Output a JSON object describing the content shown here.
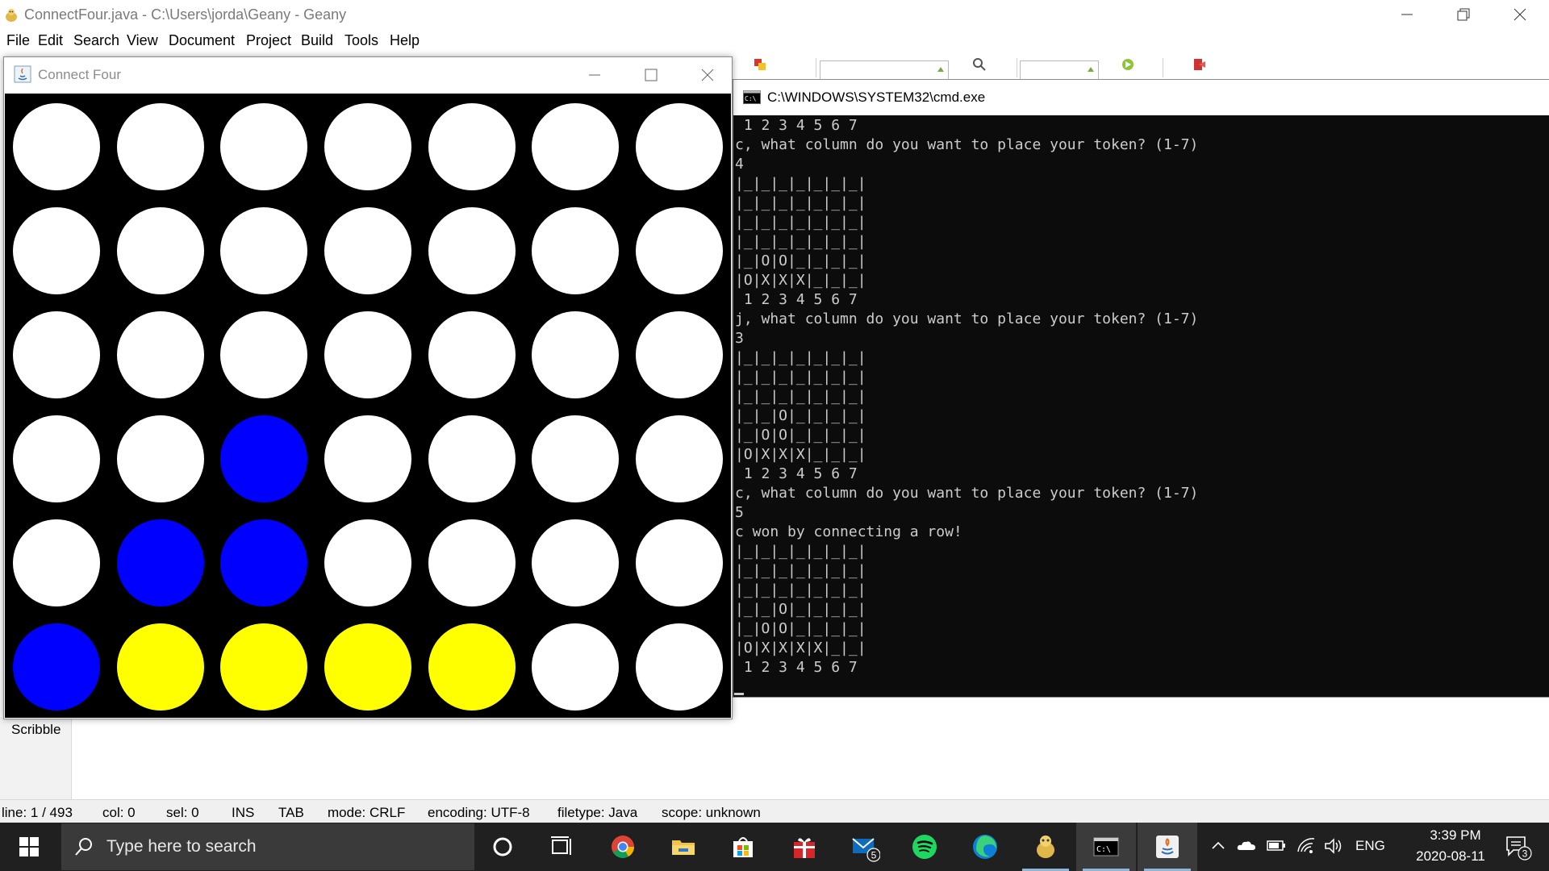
{
  "geany": {
    "title": "ConnectFour.java - C:\\Users\\jorda\\Geany - Geany",
    "menu": [
      {
        "label": "File"
      },
      {
        "label": "Edit"
      },
      {
        "label": "Search"
      },
      {
        "label": "View"
      },
      {
        "label": "Document"
      },
      {
        "label": "Project"
      },
      {
        "label": "Build"
      },
      {
        "label": "Tools"
      },
      {
        "label": "Help"
      }
    ],
    "scribble_tab": "Scribble",
    "status": {
      "line": "line: 1 / 493",
      "col": "col: 0",
      "sel": "sel: 0",
      "ins": "INS",
      "tab": "TAB",
      "mode": "mode: CRLF",
      "encoding": "encoding: UTF-8",
      "filetype": "filetype: Java",
      "scope": "scope: unknown"
    }
  },
  "connect_four": {
    "title": "Connect Four",
    "colors": {
      "empty": "#ffffff",
      "blue": "#0000ff",
      "yellow": "#ffff00",
      "board": "#000000"
    },
    "board": [
      [
        "empty",
        "empty",
        "empty",
        "empty",
        "empty",
        "empty",
        "empty"
      ],
      [
        "empty",
        "empty",
        "empty",
        "empty",
        "empty",
        "empty",
        "empty"
      ],
      [
        "empty",
        "empty",
        "empty",
        "empty",
        "empty",
        "empty",
        "empty"
      ],
      [
        "empty",
        "empty",
        "blue",
        "empty",
        "empty",
        "empty",
        "empty"
      ],
      [
        "empty",
        "blue",
        "blue",
        "empty",
        "empty",
        "empty",
        "empty"
      ],
      [
        "blue",
        "yellow",
        "yellow",
        "yellow",
        "yellow",
        "empty",
        "empty"
      ]
    ]
  },
  "cmd": {
    "title": "C:\\WINDOWS\\SYSTEM32\\cmd.exe",
    "output": " 1 2 3 4 5 6 7\nc, what column do you want to place your token? (1-7)\n4\n|_|_|_|_|_|_|_|\n|_|_|_|_|_|_|_|\n|_|_|_|_|_|_|_|\n|_|_|_|_|_|_|_|\n|_|O|O|_|_|_|_|\n|O|X|X|X|_|_|_|\n 1 2 3 4 5 6 7\nj, what column do you want to place your token? (1-7)\n3\n|_|_|_|_|_|_|_|\n|_|_|_|_|_|_|_|\n|_|_|_|_|_|_|_|\n|_|_|O|_|_|_|_|\n|_|O|O|_|_|_|_|\n|O|X|X|X|_|_|_|\n 1 2 3 4 5 6 7\nc, what column do you want to place your token? (1-7)\n5\nc won by connecting a row!\n|_|_|_|_|_|_|_|\n|_|_|_|_|_|_|_|\n|_|_|_|_|_|_|_|\n|_|_|O|_|_|_|_|\n|_|O|O|_|_|_|_|\n|O|X|X|X|X|_|_|\n 1 2 3 4 5 6 7"
  },
  "taskbar": {
    "search_placeholder": "Type here to search",
    "mail_badge": "5",
    "language": "ENG",
    "time": "3:39 PM",
    "date": "2020-08-11",
    "notification_count": "3"
  }
}
